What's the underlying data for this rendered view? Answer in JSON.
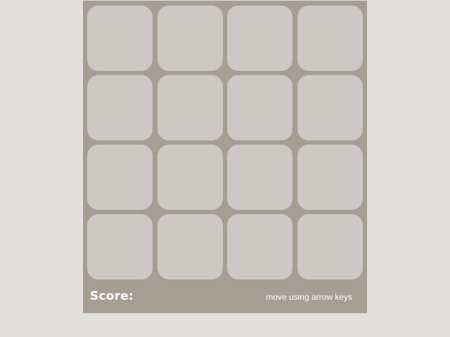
{
  "game": {
    "score_label": "Score:",
    "score_value": "",
    "hint": "move using arrow keys",
    "grid_size": 4,
    "tiles": [
      [
        "",
        "",
        "",
        ""
      ],
      [
        "",
        "",
        "",
        ""
      ],
      [
        "",
        "",
        "",
        ""
      ],
      [
        "",
        "",
        "",
        ""
      ]
    ]
  },
  "colors": {
    "page_background": "#e1e0dd",
    "board_background": "#a69e92",
    "empty_cell": "#ccc8c3",
    "text": "#ffffff"
  }
}
